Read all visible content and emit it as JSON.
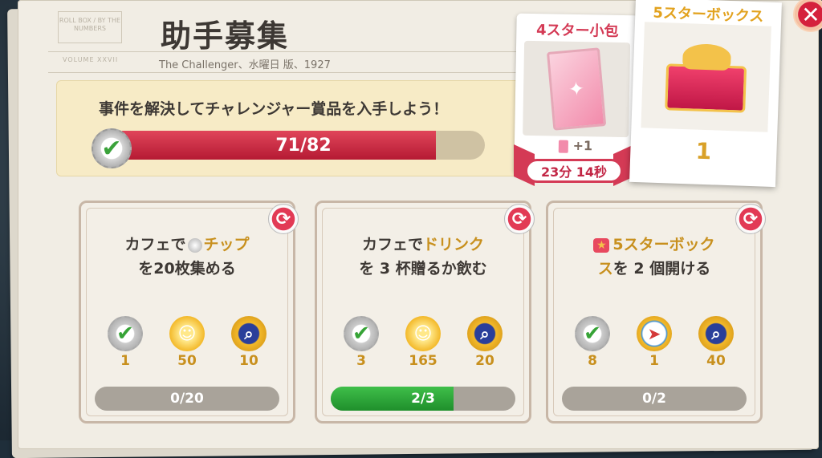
{
  "header": {
    "stamp_text": "ROLL BOX / BY THE NUMBERS",
    "volume_text": "VOLUME XXVII",
    "title": "助手募集",
    "subtitle": "The Challenger、水曜日 版、1927"
  },
  "banner": {
    "text": "事件を解決してチャレンジャー賞品を入手しよう！",
    "progress_text": "71/82",
    "progress_fraction": 0.866
  },
  "prize_4star": {
    "title": "4スター小包",
    "count_label": "+1",
    "timer": "23分 14秒"
  },
  "prize_5star": {
    "title": "5スターボックス",
    "count": "1"
  },
  "close_label": "✕",
  "tasks": [
    {
      "desc_pre": "カフェで",
      "desc_hl": "チップ",
      "desc_post": "を20枚集める",
      "rewards": [
        {
          "icon": "check-badge-icon",
          "glyph": "✔",
          "value": "1"
        },
        {
          "icon": "coin-icon",
          "glyph": "☺",
          "value": "50"
        },
        {
          "icon": "magnifier-badge-icon",
          "glyph": "⌕",
          "value": "10"
        }
      ],
      "progress_text": "0/20",
      "progress_fraction": 0
    },
    {
      "desc_pre": "カフェで",
      "desc_hl": "ドリンク",
      "desc_post": "を 3 杯贈るか飲む",
      "rewards": [
        {
          "icon": "check-badge-icon",
          "glyph": "✔",
          "value": "3"
        },
        {
          "icon": "coin-icon",
          "glyph": "☺",
          "value": "165"
        },
        {
          "icon": "magnifier-badge-icon",
          "glyph": "⌕",
          "value": "20"
        }
      ],
      "progress_text": "2/3",
      "progress_fraction": 0.667
    },
    {
      "desc_hl": "5スターボック",
      "desc_hl2": "ス",
      "desc_post": "を 2 個開ける",
      "rewards": [
        {
          "icon": "check-badge-icon",
          "glyph": "✔",
          "value": "8"
        },
        {
          "icon": "compass-icon",
          "glyph": "➤",
          "value": "1"
        },
        {
          "icon": "magnifier-badge-icon",
          "glyph": "⌕",
          "value": "40"
        }
      ],
      "progress_text": "0/2",
      "progress_fraction": 0
    }
  ]
}
